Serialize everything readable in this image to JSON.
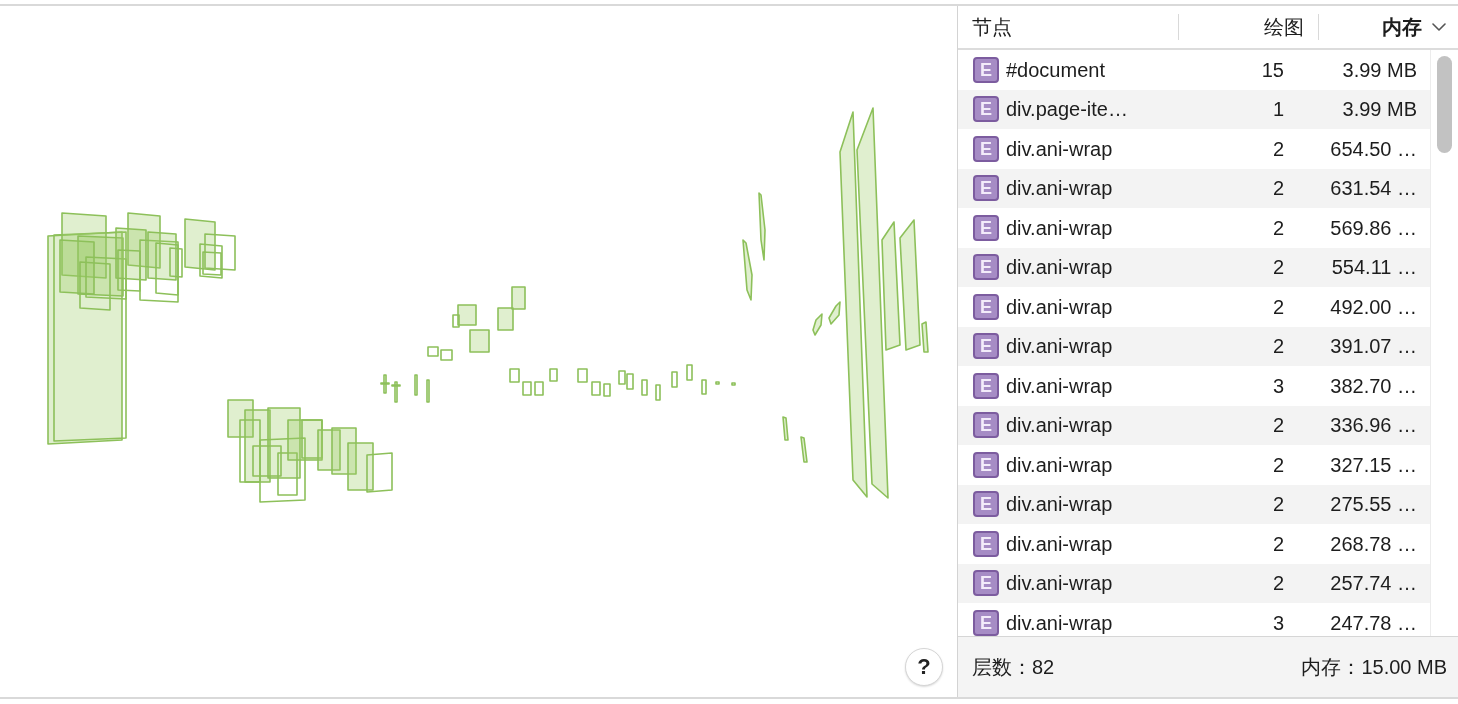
{
  "layers_view": {
    "help_button": "?"
  },
  "layers_table": {
    "columns": [
      {
        "label": "节点",
        "sorted": false
      },
      {
        "label": "绘图",
        "sorted": false
      },
      {
        "label": "内存",
        "sorted": true
      }
    ],
    "rows": [
      {
        "badge": "E",
        "node": "#document",
        "paints": "15",
        "memory": "3.99 MB"
      },
      {
        "badge": "E",
        "node": "div.page-ite…",
        "paints": "1",
        "memory": "3.99 MB"
      },
      {
        "badge": "E",
        "node": "div.ani-wrap",
        "paints": "2",
        "memory": "654.50 …"
      },
      {
        "badge": "E",
        "node": "div.ani-wrap",
        "paints": "2",
        "memory": "631.54 …"
      },
      {
        "badge": "E",
        "node": "div.ani-wrap",
        "paints": "2",
        "memory": "569.86 …"
      },
      {
        "badge": "E",
        "node": "div.ani-wrap",
        "paints": "2",
        "memory": "554.11 …"
      },
      {
        "badge": "E",
        "node": "div.ani-wrap",
        "paints": "2",
        "memory": "492.00 …"
      },
      {
        "badge": "E",
        "node": "div.ani-wrap",
        "paints": "2",
        "memory": "391.07 …"
      },
      {
        "badge": "E",
        "node": "div.ani-wrap",
        "paints": "3",
        "memory": "382.70 …"
      },
      {
        "badge": "E",
        "node": "div.ani-wrap",
        "paints": "2",
        "memory": "336.96 …"
      },
      {
        "badge": "E",
        "node": "div.ani-wrap",
        "paints": "2",
        "memory": "327.15 …"
      },
      {
        "badge": "E",
        "node": "div.ani-wrap",
        "paints": "2",
        "memory": "275.55 …"
      },
      {
        "badge": "E",
        "node": "div.ani-wrap",
        "paints": "2",
        "memory": "268.78 …"
      },
      {
        "badge": "E",
        "node": "div.ani-wrap",
        "paints": "2",
        "memory": "257.74 …"
      },
      {
        "badge": "E",
        "node": "div.ani-wrap",
        "paints": "3",
        "memory": "247.78 …"
      }
    ]
  },
  "status_bar": {
    "layer_count": "层数：82",
    "memory": "内存：15.00 MB"
  }
}
